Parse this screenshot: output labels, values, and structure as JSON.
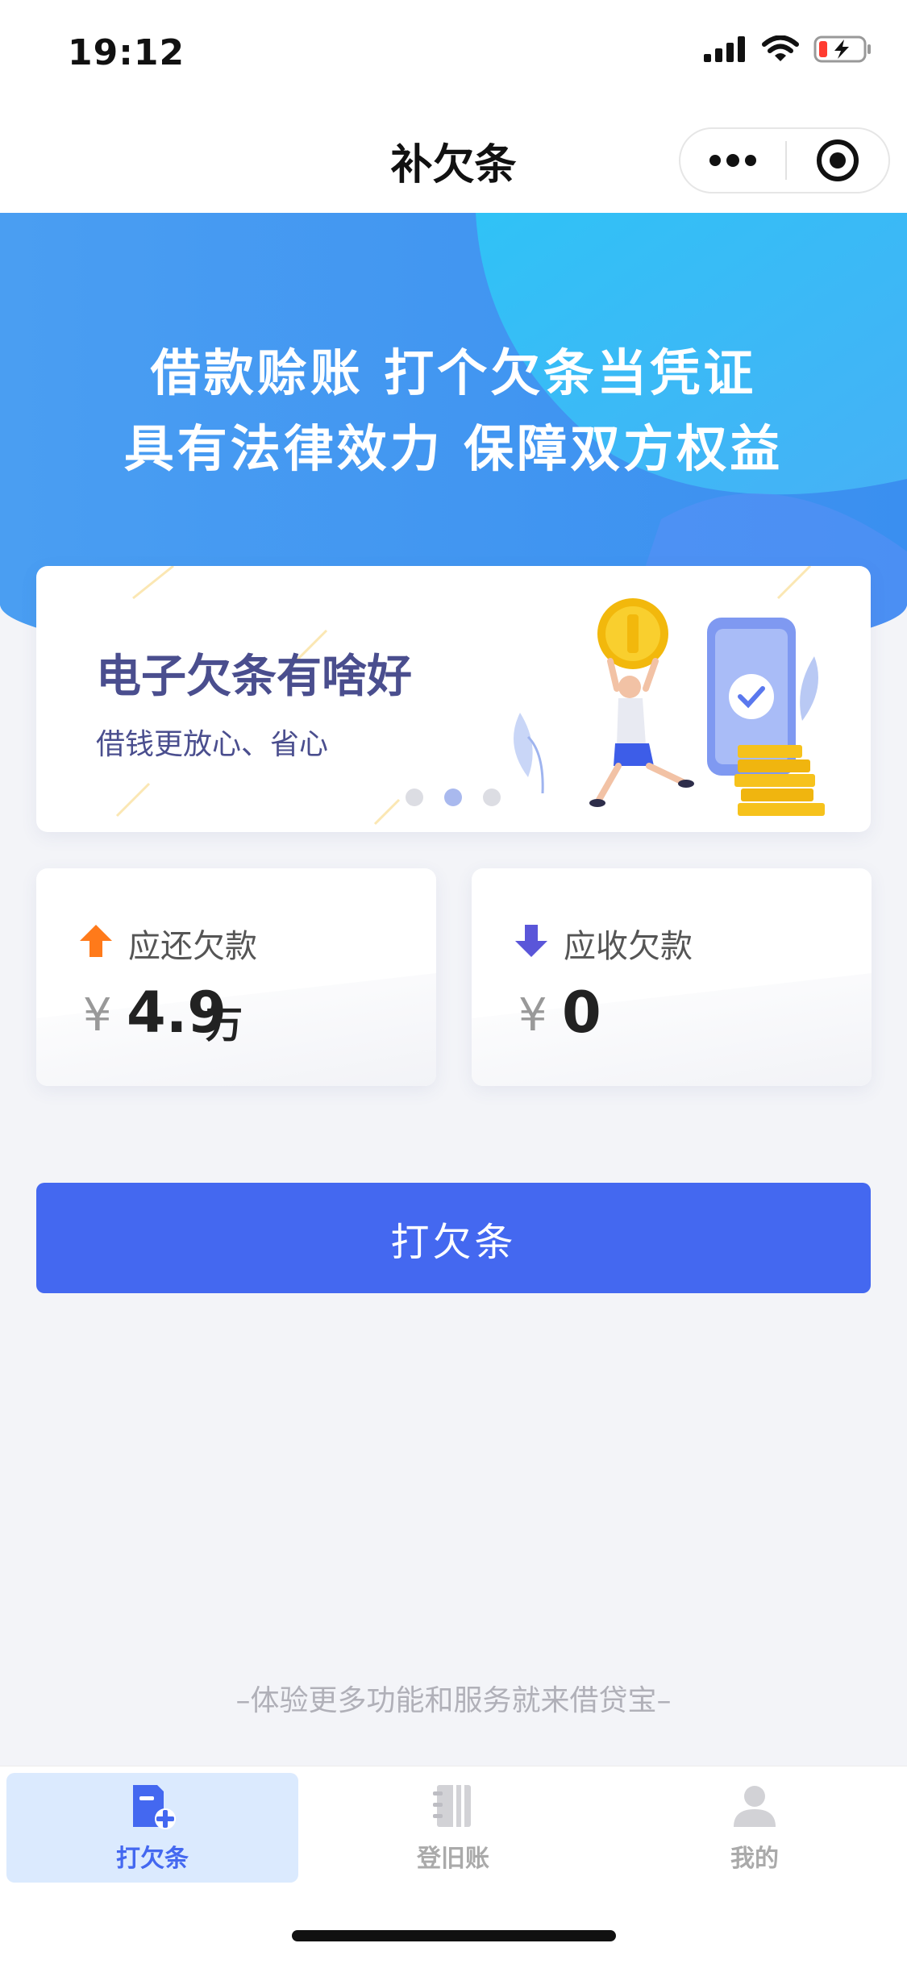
{
  "status_bar": {
    "time": "19:12",
    "icons": [
      "cellular-signal-icon",
      "wifi-icon",
      "battery-low-charging-icon"
    ]
  },
  "nav": {
    "title": "补欠条",
    "more_icon": "more-dots-icon",
    "close_icon": "target-close-icon"
  },
  "banner": {
    "line1": "借款赊账 打个欠条当凭证",
    "line2": "具有法律效力 保障双方权益"
  },
  "promo": {
    "title": "电子欠条有啥好",
    "subtitle": "借钱更放心、省心",
    "carousel_total": 3,
    "carousel_active": 2
  },
  "stats": {
    "payable": {
      "label": "应还欠款",
      "currency": "¥",
      "amount": "4.9",
      "unit": "万",
      "icon": "arrow-up-icon",
      "icon_color": "#ff7a1a"
    },
    "receivable": {
      "label": "应收欠款",
      "currency": "¥",
      "amount": "0",
      "icon": "arrow-down-icon",
      "icon_color": "#5a56d9"
    }
  },
  "main_button": {
    "label": "打欠条"
  },
  "footer_note": "–体验更多功能和服务就来借贷宝–",
  "tabbar": {
    "items": [
      {
        "label": "打欠条",
        "icon": "document-add-icon",
        "active": true
      },
      {
        "label": "登旧账",
        "icon": "notebook-icon",
        "active": false
      },
      {
        "label": "我的",
        "icon": "user-icon",
        "active": false
      }
    ]
  },
  "colors": {
    "primary": "#4468f0",
    "banner": "#4ba2f2",
    "background": "#f3f4f8",
    "text_dark": "#4a4e8e"
  }
}
